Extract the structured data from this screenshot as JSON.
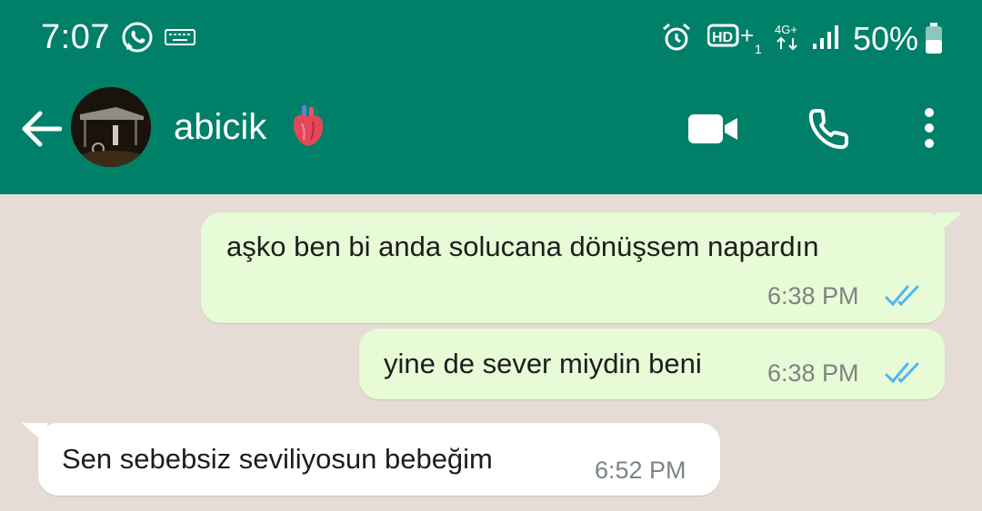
{
  "status_bar": {
    "time": "7:07",
    "network": "4G+",
    "battery": "50%",
    "icons": [
      "whatsapp-icon",
      "keyboard-icon",
      "alarm-icon",
      "hd-voice-icon",
      "network-icon",
      "signal-icon",
      "battery-icon"
    ]
  },
  "header": {
    "contact_name": "abicik",
    "contact_emoji": "anatomical-heart-icon",
    "actions": [
      "back-icon",
      "video-call-icon",
      "voice-call-icon",
      "more-options-icon"
    ]
  },
  "messages": [
    {
      "direction": "outgoing",
      "text": "aşko ben bi anda solucana dönüşsem napardın",
      "time": "6:38 PM",
      "status": "read"
    },
    {
      "direction": "outgoing",
      "text": "yine de sever miydin beni",
      "time": "6:38 PM",
      "status": "read"
    },
    {
      "direction": "incoming",
      "text": "Sen sebebsiz seviliyosun bebeğim",
      "time": "6:52 PM"
    }
  ],
  "colors": {
    "header": "#008069",
    "chat_background": "#e5ddd5",
    "outgoing_bubble": "#e7fbd6",
    "incoming_bubble": "#ffffff",
    "read_ticks": "#4fb6ec"
  }
}
